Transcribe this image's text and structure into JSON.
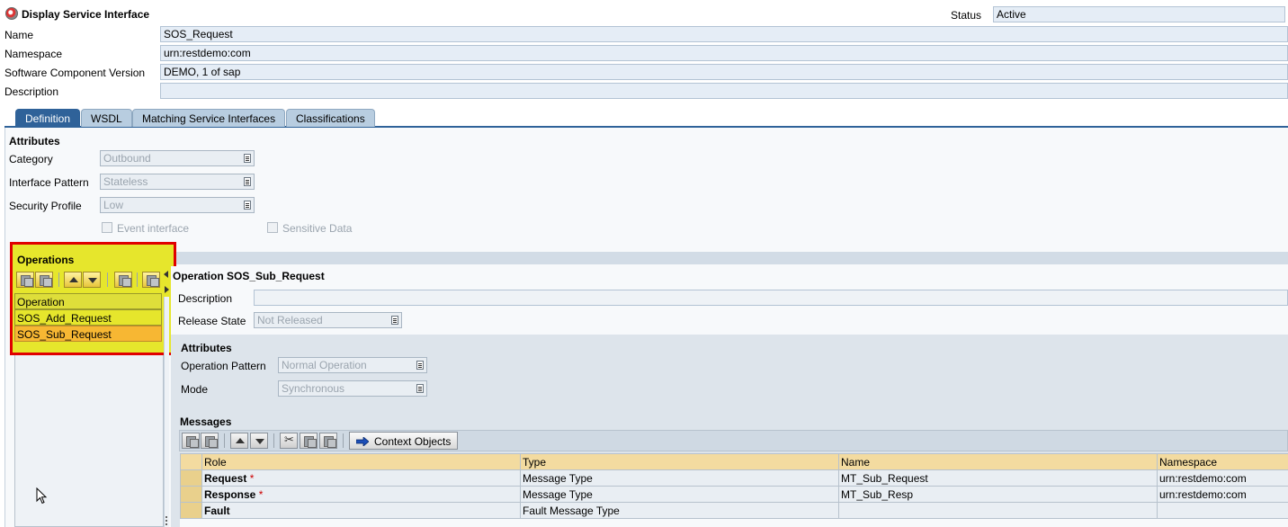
{
  "window": {
    "title": "Display Service Interface"
  },
  "status": {
    "label": "Status",
    "value": "Active"
  },
  "header": {
    "name_label": "Name",
    "name_value": "SOS_Request",
    "namespace_label": "Namespace",
    "namespace_value": "urn:restdemo:com",
    "scv_label": "Software Component Version",
    "scv_value": "DEMO, 1 of sap",
    "description_label": "Description",
    "description_value": ""
  },
  "tabs": [
    {
      "label": "Definition"
    },
    {
      "label": "WSDL"
    },
    {
      "label": "Matching Service Interfaces"
    },
    {
      "label": "Classifications"
    }
  ],
  "attributes": {
    "heading": "Attributes",
    "category_label": "Category",
    "category_value": "Outbound",
    "pattern_label": "Interface Pattern",
    "pattern_value": "Stateless",
    "security_label": "Security Profile",
    "security_value": "Low",
    "event_label": "Event interface",
    "sensitive_label": "Sensitive Data"
  },
  "operations": {
    "heading": "Operations",
    "column": "Operation",
    "rows": [
      "SOS_Add_Request",
      "SOS_Sub_Request"
    ],
    "selected": "SOS_Sub_Request"
  },
  "operation_detail": {
    "title": "Operation SOS_Sub_Request",
    "description_label": "Description",
    "release_label": "Release State",
    "release_value": "Not Released",
    "attributes_heading": "Attributes",
    "op_pattern_label": "Operation Pattern",
    "op_pattern_value": "Normal Operation",
    "mode_label": "Mode",
    "mode_value": "Synchronous"
  },
  "messages": {
    "heading": "Messages",
    "context_button": "Context Objects",
    "columns": [
      "Role",
      "Type",
      "Name",
      "Namespace"
    ],
    "rows": [
      {
        "role": "Request",
        "required": "*",
        "type": "Message Type",
        "name": "MT_Sub_Request",
        "namespace": "urn:restdemo:com"
      },
      {
        "role": "Response",
        "required": "*",
        "type": "Message Type",
        "name": "MT_Sub_Resp",
        "namespace": "urn:restdemo:com"
      },
      {
        "role": "Fault",
        "required": "",
        "type": "Fault Message Type",
        "name": "",
        "namespace": ""
      }
    ]
  },
  "colors": {
    "highlight_border": "#e00000",
    "highlight_fill": "#e6e62c",
    "tab_active": "#2f6299"
  }
}
